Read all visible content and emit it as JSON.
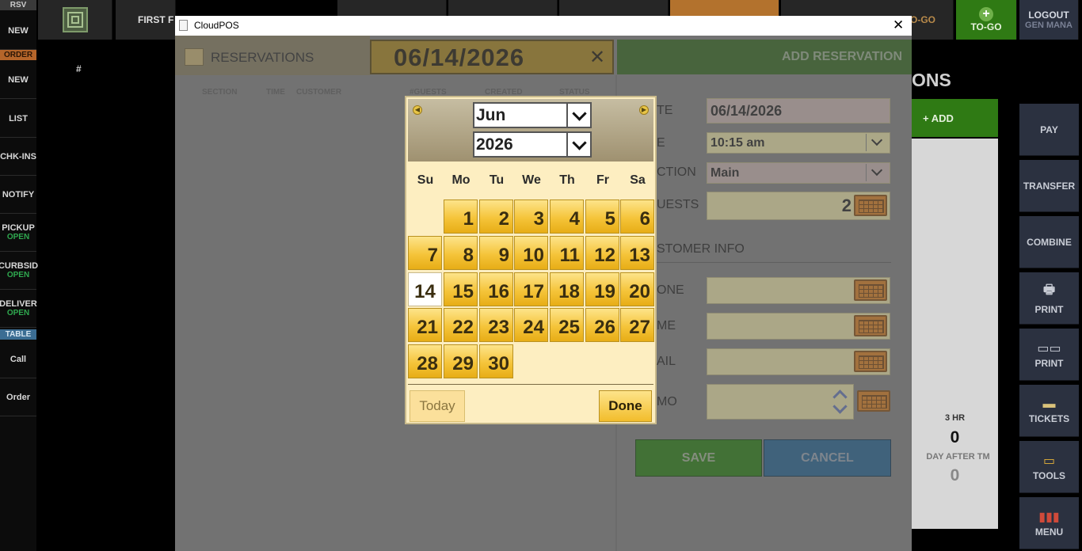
{
  "left_sidebar": {
    "header_rsv": "RSV",
    "header_order": "ORDER",
    "header_table": "TABLE",
    "hash": "#",
    "items": [
      {
        "label": "NEW",
        "sub": ""
      },
      {
        "label": "NEW",
        "sub": ""
      },
      {
        "label": "LIST",
        "sub": ""
      },
      {
        "label": "CHK-INS",
        "sub": ""
      },
      {
        "label": "NOTIFY",
        "sub": ""
      },
      {
        "label": "PICKUP",
        "sub": "OPEN"
      },
      {
        "label": "CURBSID",
        "sub": "OPEN"
      },
      {
        "label": "DELIVER",
        "sub": "OPEN"
      },
      {
        "label": "Call",
        "sub": ""
      },
      {
        "label": "Order",
        "sub": ""
      }
    ]
  },
  "top_bar": {
    "first_label": "FIRST F",
    "togo_label": "TO-GO",
    "togo_button": "TO-GO",
    "logout_line1": "LOGOUT",
    "logout_line2": "GEN MANA"
  },
  "right_panel": {
    "heading": "ONS",
    "add_button": "+ ADD",
    "stats": {
      "label1": "3 HR",
      "value1": "0",
      "label2": "DAY AFTER TM",
      "value2": "0"
    },
    "buttons": [
      {
        "label": "PAY",
        "icon": "pay-icon"
      },
      {
        "label": "TRANSFER",
        "icon": "transfer-icon"
      },
      {
        "label": "COMBINE",
        "icon": "combine-icon"
      },
      {
        "label": "PRINT",
        "icon": "printer-icon"
      },
      {
        "label": "PRINT",
        "icon": "kitchen-printer-icon"
      },
      {
        "label": "TICKETS",
        "icon": "tickets-icon"
      },
      {
        "label": "TOOLS",
        "icon": "tools-icon"
      },
      {
        "label": "MENU",
        "icon": "menu-chart-icon"
      }
    ]
  },
  "window": {
    "title": "CloudPOS",
    "close": "✕",
    "reservations_label": "RESERVATIONS",
    "date_value": "06/14/2026",
    "clear_date": "✕",
    "add_reservation": "ADD RESERVATION",
    "list_columns": [
      "SECTION",
      "TIME",
      "CUSTOMER",
      "#GUESTS",
      "CREATED",
      "STATUS"
    ],
    "form": {
      "date_label": "TE",
      "date_value": "06/14/2026",
      "time_label": "E",
      "time_value": "10:15 am",
      "section_label": "CTION",
      "section_value": "Main",
      "guests_label": "UESTS",
      "guests_value": "2",
      "customer_info_label": "STOMER INFO",
      "phone_label": "ONE",
      "name_label": "ME",
      "email_label": "AIL",
      "memo_label": "MO",
      "save_button": "SAVE",
      "cancel_button": "CANCEL"
    }
  },
  "calendar": {
    "month": "Jun",
    "year": "2026",
    "weekdays": [
      "Su",
      "Mo",
      "Tu",
      "We",
      "Th",
      "Fr",
      "Sa"
    ],
    "first_weekday_index": 1,
    "days_in_month": 30,
    "selected_day": 14,
    "today_button": "Today",
    "done_button": "Done"
  },
  "colors": {
    "accent_gold": "#f5c43a",
    "add_green": "#2f7a14",
    "cancel_blue": "#1f5a86",
    "save_green": "#24740f"
  }
}
